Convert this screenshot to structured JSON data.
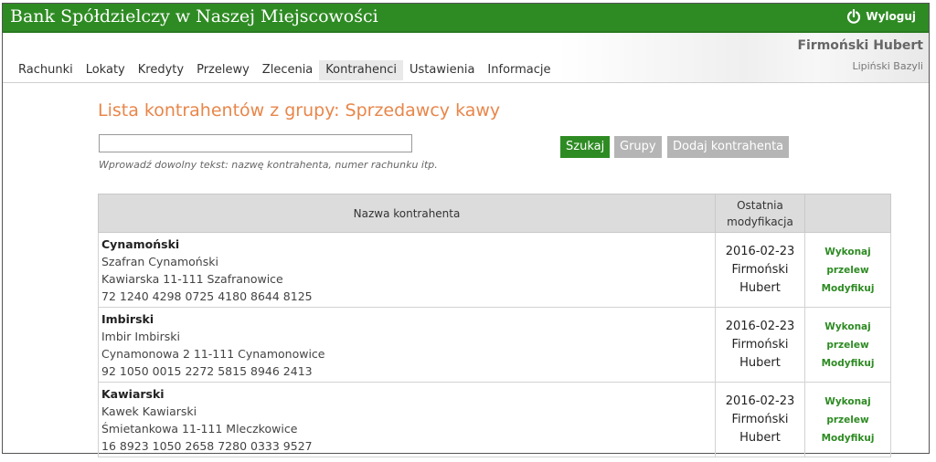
{
  "header": {
    "brand": "Bank Spółdzielczy w Naszej Miejscowości",
    "logout_label": "Wyloguj"
  },
  "nav": {
    "items": [
      "Rachunki",
      "Lokaty",
      "Kredyty",
      "Przelewy",
      "Zlecenia",
      "Kontrahenci",
      "Ustawienia",
      "Informacje"
    ],
    "active": "Kontrahenci"
  },
  "user": {
    "name": "Firmoński Hubert",
    "sub": "Lipiński Bazyli"
  },
  "page": {
    "title": "Lista kontrahentów z grupy: Sprzedawcy kawy",
    "search_value": "",
    "hint": "Wprowadź dowolny tekst: nazwę kontrahenta, numer rachunku itp."
  },
  "buttons": {
    "search": "Szukaj",
    "groups": "Grupy",
    "add": "Dodaj kontrahenta"
  },
  "table": {
    "col_name": "Nazwa kontrahenta",
    "col_modified": "Ostatnia modyfikacja",
    "actions": {
      "transfer": "Wykonaj przelew",
      "modify": "Modyfikuj"
    },
    "rows": [
      {
        "name": "Cynamoński",
        "person": "Szafran Cynamoński",
        "address": "Kawiarska 11-111 Szafranowice",
        "account": "72 1240 4298 0725 4180 8644 8125",
        "date": "2016-02-23",
        "by": "Firmoński Hubert"
      },
      {
        "name": "Imbirski",
        "person": "Imbir Imbirski",
        "address": "Cynamonowa 2 11-111 Cynamonowice",
        "account": "92 1050 0015 2272 5815 8946 2413",
        "date": "2016-02-23",
        "by": "Firmoński Hubert"
      },
      {
        "name": "Kawiarski",
        "person": "Kawek Kawiarski",
        "address": "Śmietankowa 11-111 Mleczkowice",
        "account": "16 8923 1050 2658 7280 0333 9527",
        "date": "2016-02-23",
        "by": "Firmoński Hubert"
      }
    ]
  },
  "colors": {
    "brand_green": "#2e8b23",
    "title_orange": "#e8864a",
    "button_gray": "#b5b5b5"
  }
}
